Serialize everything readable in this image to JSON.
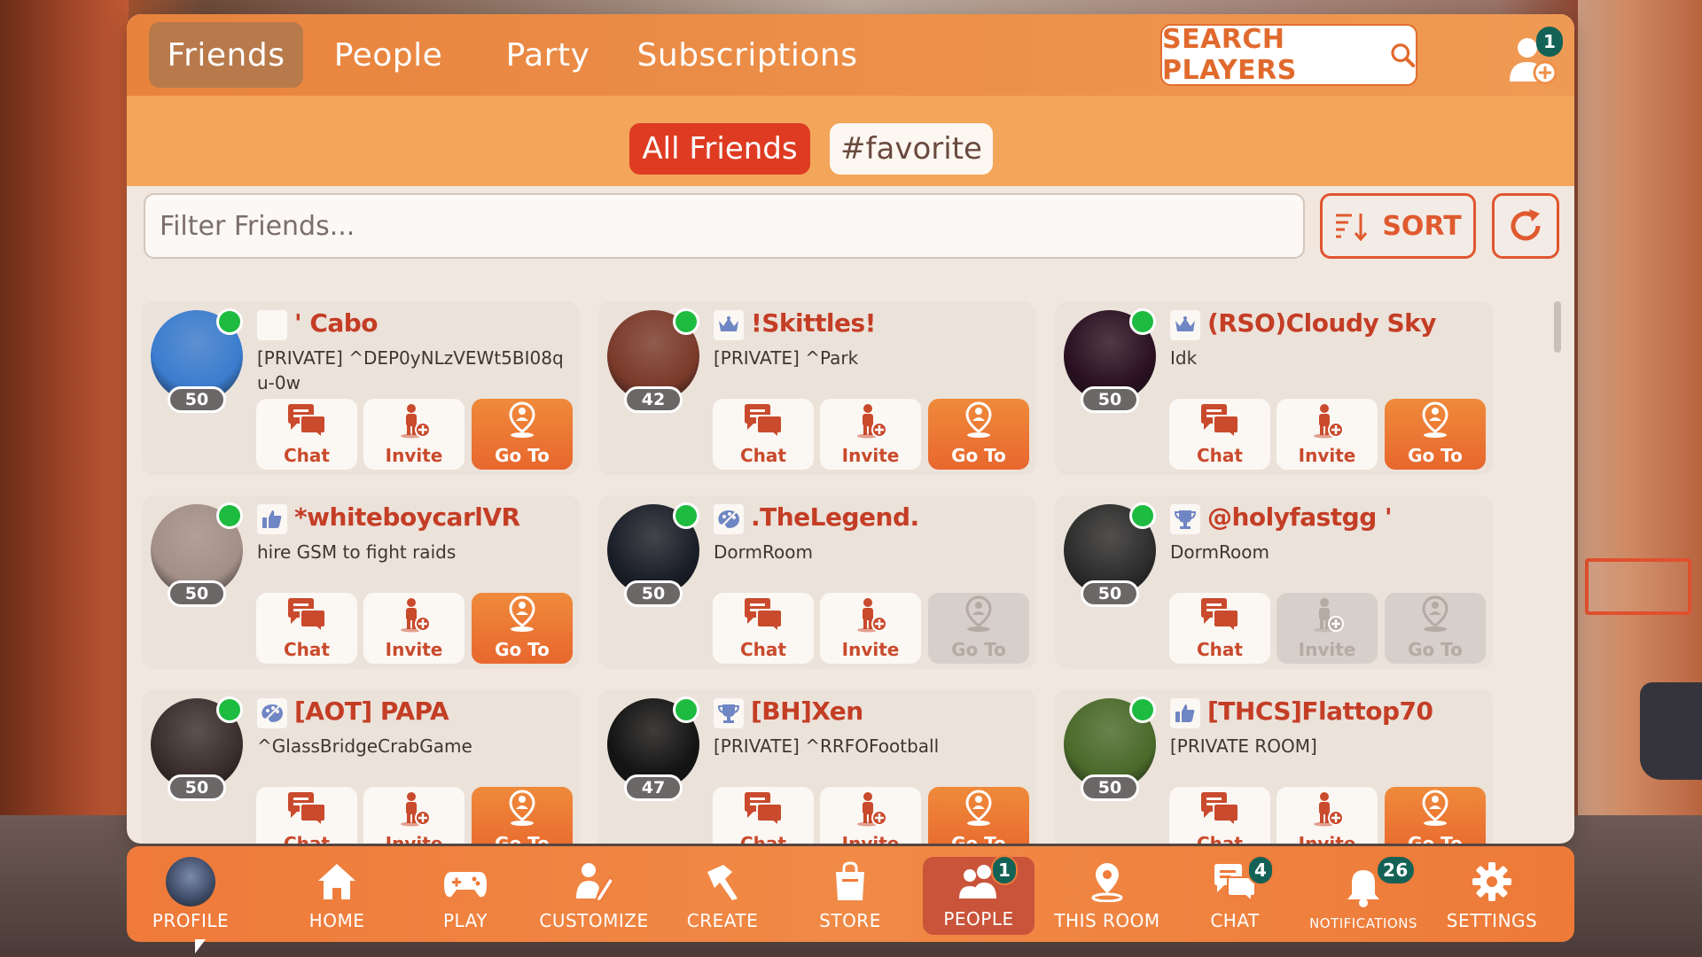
{
  "header": {
    "tabs": [
      {
        "label": "Friends",
        "active": true
      },
      {
        "label": "People",
        "active": false
      },
      {
        "label": "Party",
        "active": false
      },
      {
        "label": "Subscriptions",
        "active": false
      }
    ],
    "search_label": "SEARCH PLAYERS",
    "friend_requests_count": "1"
  },
  "subtabs": [
    {
      "label": "All Friends",
      "active": true
    },
    {
      "label": "#favorite",
      "active": false
    }
  ],
  "filter": {
    "placeholder": "Filter Friends..."
  },
  "sort_label": "SORT",
  "action_labels": {
    "chat": "Chat",
    "invite": "Invite",
    "goto": "Go To"
  },
  "friends": [
    {
      "name": "' Cabo",
      "status": "[PRIVATE] ^DEP0yNLzVEWt5BI08qu-0w",
      "level": "50",
      "rank_icon": "blank",
      "invite_enabled": true,
      "goto_enabled": true,
      "avatar_color": "#3a7ccf"
    },
    {
      "name": "!Skittles!",
      "status": "[PRIVATE] ^Park",
      "level": "42",
      "rank_icon": "crown-icon",
      "invite_enabled": true,
      "goto_enabled": true,
      "avatar_color": "#7a3a2a"
    },
    {
      "name": "(RSO)Cloudy Sky",
      "status": "Idk",
      "level": "50",
      "rank_icon": "crown-icon",
      "invite_enabled": true,
      "goto_enabled": true,
      "avatar_color": "#2a1020"
    },
    {
      "name": "*whiteboycarlVR",
      "status": "hire GSM to fight raids",
      "level": "50",
      "rank_icon": "thumbs-up-icon",
      "invite_enabled": true,
      "goto_enabled": true,
      "avatar_color": "#a38f88"
    },
    {
      "name": ".TheLegend.",
      "status": "DormRoom",
      "level": "50",
      "rank_icon": "palette-icon",
      "invite_enabled": true,
      "goto_enabled": false,
      "avatar_color": "#1a1e28"
    },
    {
      "name": "@holyfastgg '",
      "status": "DormRoom",
      "level": "50",
      "rank_icon": "trophy-icon",
      "invite_enabled": false,
      "goto_enabled": false,
      "avatar_color": "#2c2c2c"
    },
    {
      "name": "[AOT] PAPA",
      "status": "^GlassBridgeCrabGame",
      "level": "50",
      "rank_icon": "palette-icon",
      "invite_enabled": true,
      "goto_enabled": true,
      "avatar_color": "#3a2e2c"
    },
    {
      "name": "[BH]Xen",
      "status": "[PRIVATE] ^RRFOFootball",
      "level": "47",
      "rank_icon": "trophy-icon",
      "invite_enabled": true,
      "goto_enabled": true,
      "avatar_color": "#141414"
    },
    {
      "name": "[THCS]Flattop70",
      "status": "[PRIVATE ROOM]",
      "level": "50",
      "rank_icon": "thumbs-up-icon",
      "invite_enabled": true,
      "goto_enabled": true,
      "avatar_color": "#4a6a2a"
    }
  ],
  "nav": [
    {
      "label": "PROFILE",
      "icon": "avatar",
      "badge": ""
    },
    {
      "label": "HOME",
      "icon": "home-icon",
      "badge": ""
    },
    {
      "label": "PLAY",
      "icon": "gamepad-icon",
      "badge": ""
    },
    {
      "label": "CUSTOMIZE",
      "icon": "customize-icon",
      "badge": ""
    },
    {
      "label": "CREATE",
      "icon": "create-icon",
      "badge": ""
    },
    {
      "label": "STORE",
      "icon": "store-icon",
      "badge": ""
    },
    {
      "label": "PEOPLE",
      "icon": "people-icon",
      "badge": "1",
      "active": true
    },
    {
      "label": "THIS ROOM",
      "icon": "location-icon",
      "badge": ""
    },
    {
      "label": "CHAT",
      "icon": "chat-icon",
      "badge": "4"
    },
    {
      "label": "NOTIFICATIONS",
      "icon": "bell-icon",
      "badge": "26"
    },
    {
      "label": "SETTINGS",
      "icon": "gear-icon",
      "badge": ""
    }
  ],
  "colors": {
    "accent": "#e8672d",
    "name": "#c43d25",
    "online": "#1dbb3f",
    "badge": "#146256"
  }
}
